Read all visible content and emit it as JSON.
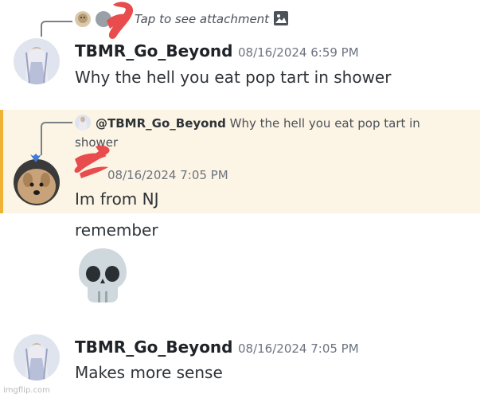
{
  "messages": [
    {
      "reply": {
        "text": "Tap to see attachment"
      },
      "username": "TBMR_Go_Beyond",
      "timestamp": "08/16/2024 6:59 PM",
      "text": "Why the hell you eat pop tart in shower"
    },
    {
      "reply": {
        "mention": "@TBMR_Go_Beyond",
        "text_line1": "Why the hell you eat pop tart in",
        "text_line2": "shower"
      },
      "timestamp": "08/16/2024 7:05 PM",
      "text": "Im from NJ",
      "followups": [
        "remember"
      ],
      "emoji": "skull"
    },
    {
      "username": "TBMR_Go_Beyond",
      "timestamp": "08/16/2024 7:05 PM",
      "text": "Makes more sense"
    }
  ],
  "watermark": "imgflip.com",
  "colors": {
    "highlight_bg": "#fcf4e4",
    "highlight_bar": "#f0b232",
    "scribble": "#e84c4c"
  }
}
